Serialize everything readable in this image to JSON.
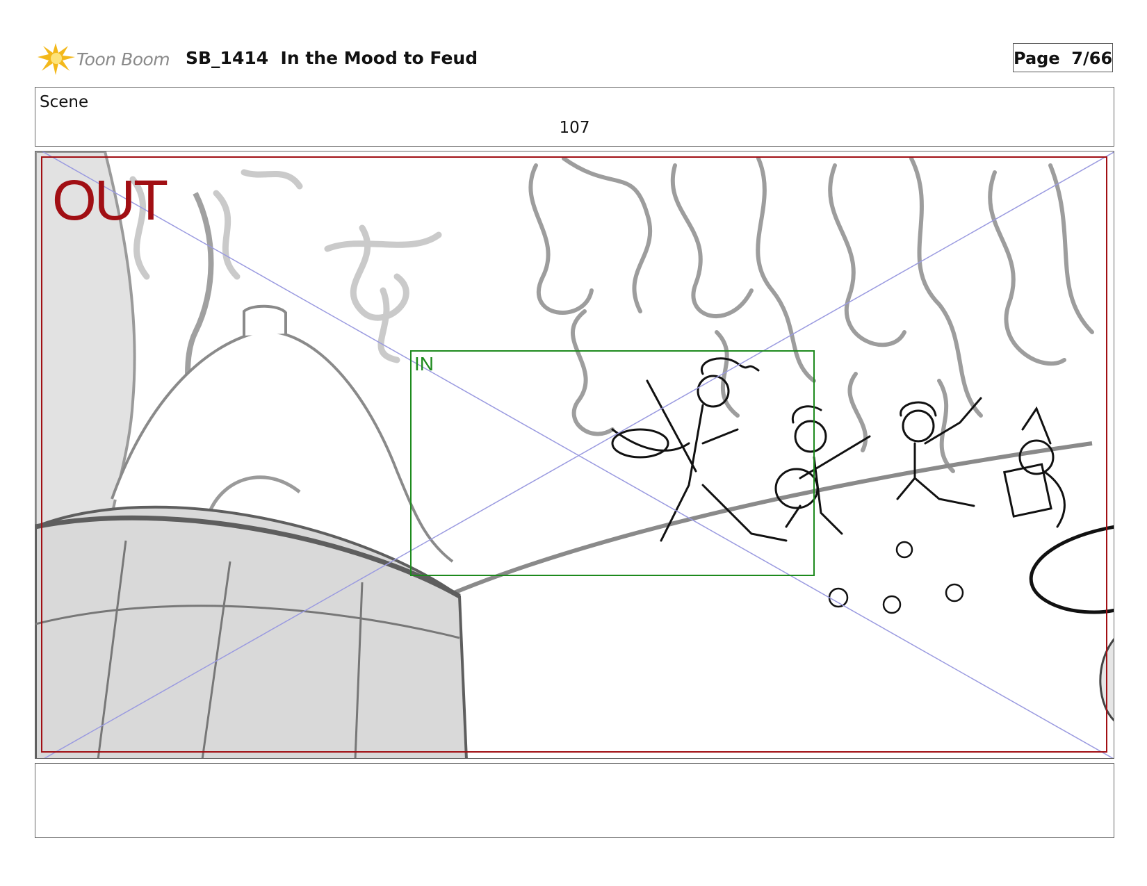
{
  "header": {
    "logo_text": "Toon Boom",
    "title": "SB_1414  In the Mood to Feud",
    "page": "Page  7/66"
  },
  "scene": {
    "label": "Scene",
    "number": "107"
  },
  "panel": {
    "out_label": "OUT",
    "in_label": "IN",
    "out_frame_color": "#a10f14",
    "in_frame_color": "#1d8a1d",
    "guide_line_color": "#9a9ae0"
  },
  "notes": {
    "text": ""
  }
}
